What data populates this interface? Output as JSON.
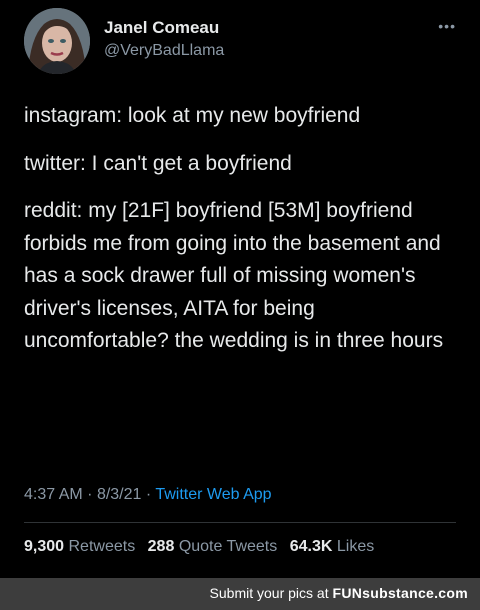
{
  "tweet": {
    "display_name": "Janel Comeau",
    "handle": "@VeryBadLlama",
    "more_icon": "ellipsis-icon",
    "lines": [
      "instagram: look at my new boyfriend",
      "twitter: I can't get a boyfriend",
      "reddit: my [21F] boyfriend [53M] boyfriend forbids me from going into the basement and has a sock drawer full of missing women's driver's licenses, AITA for being uncomfortable? the wedding is in three hours"
    ],
    "time": "4:37 AM",
    "date": "8/3/21",
    "separator": "·",
    "app": "Twitter Web App",
    "stats": {
      "retweets_count": "9,300",
      "retweets_label": "Retweets",
      "quotes_count": "288",
      "quotes_label": "Quote Tweets",
      "likes_count": "64.3K",
      "likes_label": "Likes"
    }
  },
  "footer": {
    "text": "Submit your pics at",
    "brand": "FUNsubstance.com"
  },
  "colors": {
    "background": "#000000",
    "link": "#1d9bf0",
    "secondary_text": "#8b98a5",
    "footer_bg": "#3d3d3d"
  }
}
